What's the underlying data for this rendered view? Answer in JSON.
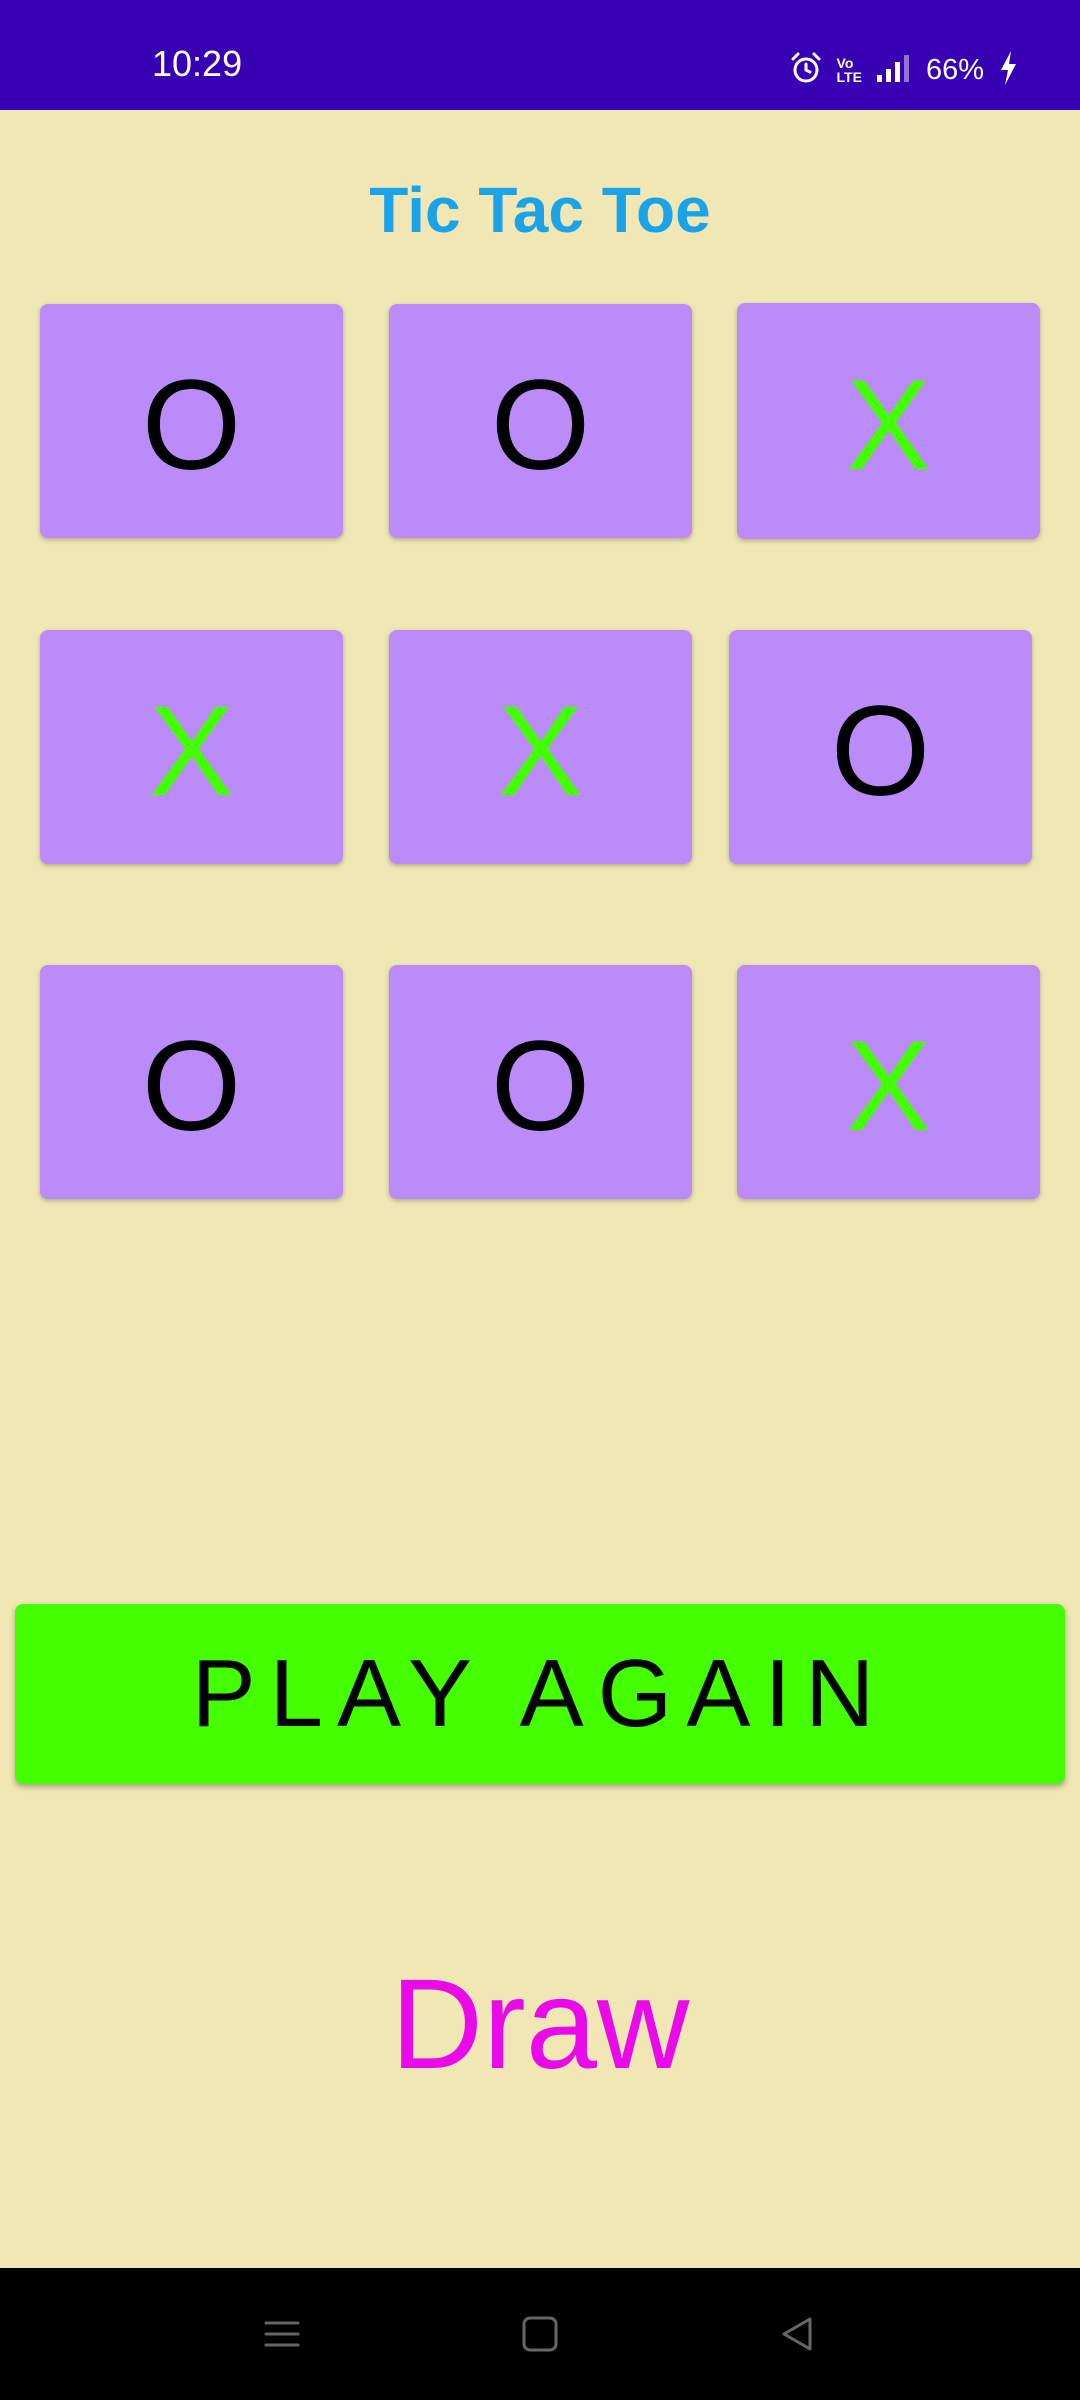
{
  "status_bar": {
    "time": "10:29",
    "battery": "66%",
    "network_label_top": "Vo",
    "network_label_bottom": "LTE",
    "icons": [
      "alarm-icon",
      "volte-icon",
      "signal-icon",
      "battery-charging-icon"
    ]
  },
  "app": {
    "title": "Tic Tac Toe"
  },
  "board": {
    "cells": [
      "O",
      "O",
      "X",
      "X",
      "X",
      "O",
      "O",
      "O",
      "X"
    ]
  },
  "actions": {
    "play_again_label": "PLAY AGAIN"
  },
  "result": {
    "text": "Draw"
  },
  "nav_bar": {
    "icons": [
      "recents-icon",
      "home-icon",
      "back-icon"
    ]
  },
  "colors": {
    "status_bar": "#3700b3",
    "background": "#f0e7b4",
    "title": "#1aa3e8",
    "cell": "#bc8bfa",
    "mark_o": "#000000",
    "mark_x": "#44ff00",
    "button": "#44ff00",
    "result": "#e80ae8"
  }
}
